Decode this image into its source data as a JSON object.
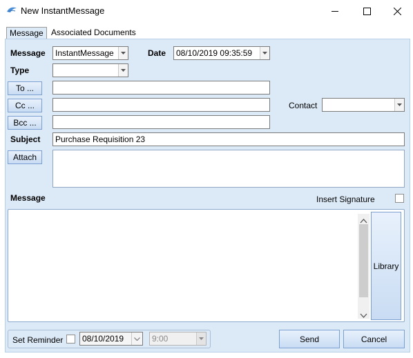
{
  "window": {
    "title": "New InstantMessage",
    "icon": "app-bird-icon",
    "controls": [
      "minimize-icon",
      "maximize-icon",
      "close-icon"
    ]
  },
  "tabs": [
    {
      "label": "Message",
      "active": true
    },
    {
      "label": "Associated Documents",
      "active": false
    }
  ],
  "form": {
    "message_label": "Message",
    "message_type_value": "InstantMessage",
    "date_label": "Date",
    "date_value": "08/10/2019 09:35:59",
    "type_label": "Type",
    "type_value": "",
    "to_button": "To ...",
    "to_value": "",
    "cc_button": "Cc ...",
    "cc_value": "",
    "contact_label": "Contact",
    "contact_value": "",
    "bcc_button": "Bcc ...",
    "bcc_value": "",
    "subject_label": "Subject",
    "subject_value": "Purchase Requisition 23",
    "attach_button": "Attach",
    "attachments": "",
    "body_label": "Message",
    "insert_signature_label": "Insert Signature",
    "insert_signature_checked": false,
    "body_text": "",
    "library_button": "Library"
  },
  "footer": {
    "set_reminder_label": "Set Reminder",
    "reminder_checked": false,
    "reminder_date": "08/10/2019",
    "reminder_time": "9:00",
    "send_button": "Send",
    "cancel_button": "Cancel"
  },
  "colors": {
    "panel_bg": "#dce9f7",
    "button_border": "#7a9fd0"
  }
}
